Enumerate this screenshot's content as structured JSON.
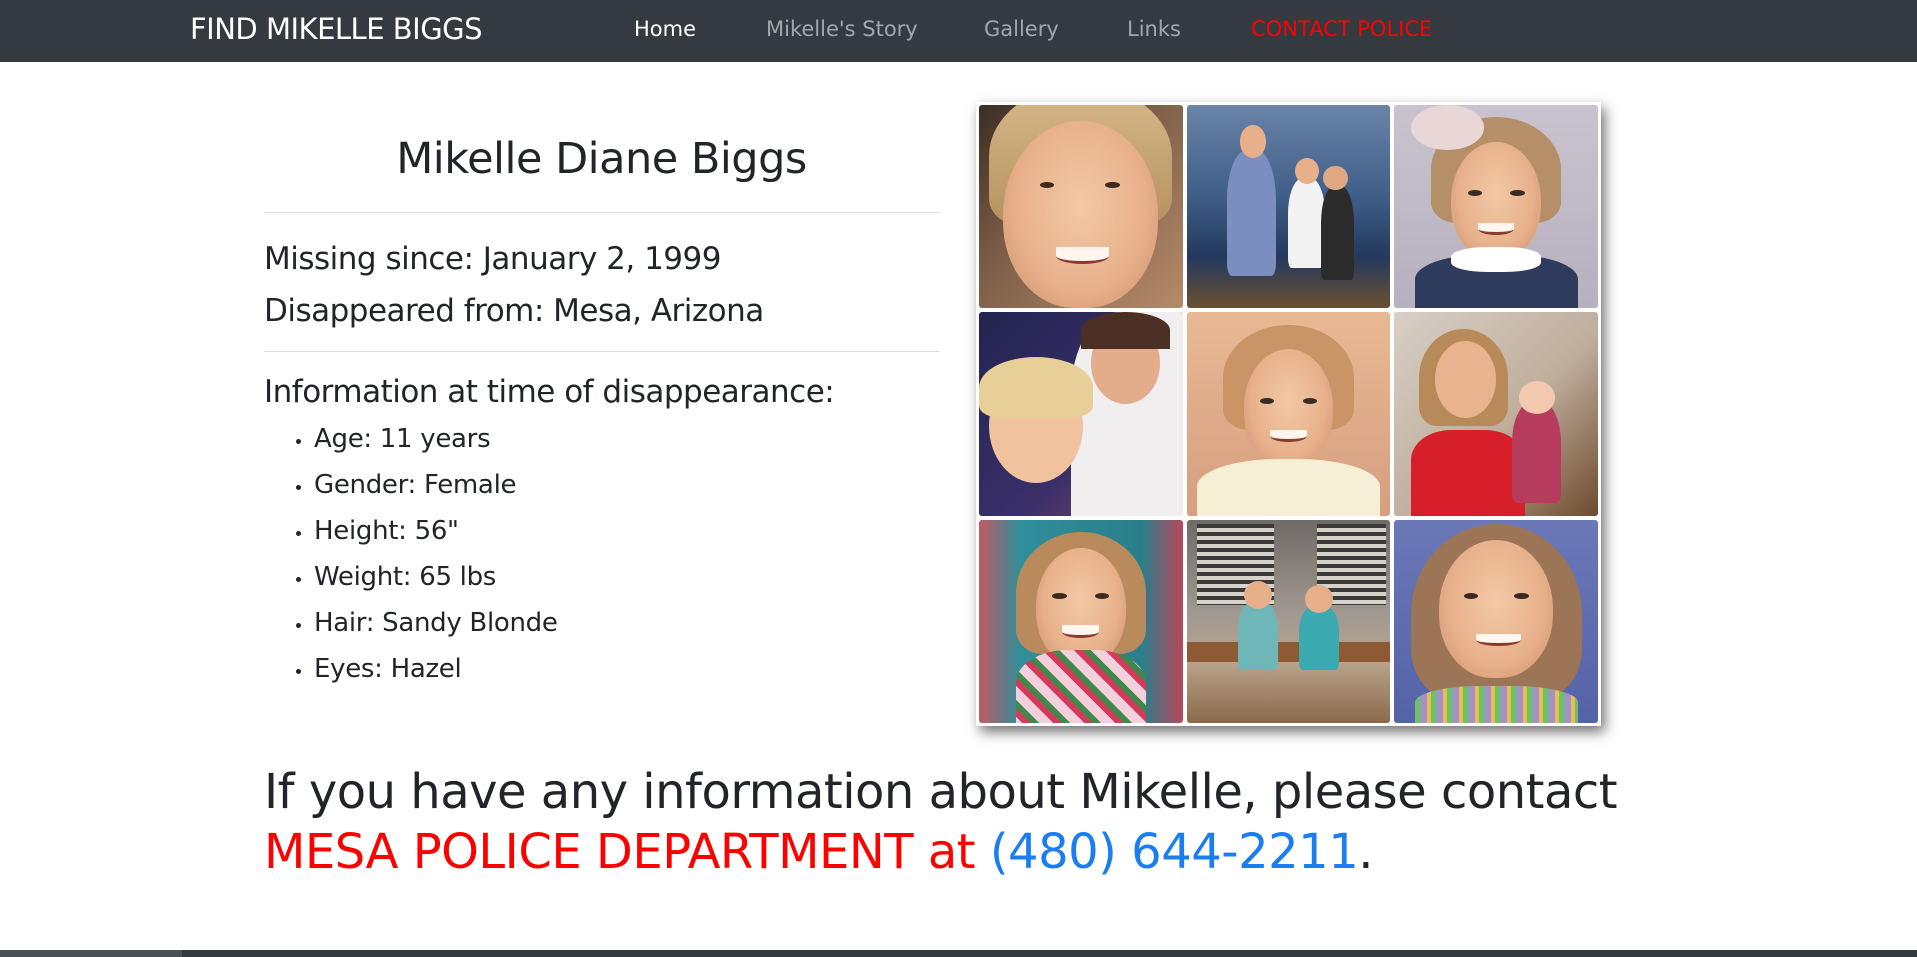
{
  "navbar": {
    "brand": "FIND MIKELLE BIGGS",
    "links": [
      {
        "label": "Home"
      },
      {
        "label": "Mikelle's Story"
      },
      {
        "label": "Gallery"
      },
      {
        "label": "Links"
      },
      {
        "label": "CONTACT POLICE"
      }
    ]
  },
  "profile": {
    "name": "Mikelle Diane Biggs",
    "missing_since": "Missing since: January 2, 1999",
    "disappeared_from": "Disappeared from: Mesa, Arizona",
    "info_heading": "Information at time of disappearance:",
    "details": [
      "Age: 11 years",
      "Gender: Female",
      "Height: 56\"",
      "Weight: 65 lbs",
      "Hair: Sandy Blonde",
      "Eyes: Hazel"
    ]
  },
  "contact": {
    "intro": "If you have any information about Mikelle, please contact",
    "agency": "MESA POLICE DEPARTMENT at",
    "phone": "(480) 644-2211",
    "end": "."
  },
  "colors": {
    "navbar_bg": "#343a40",
    "alert_red": "#ff0000",
    "link_blue": "#1a7df0"
  }
}
